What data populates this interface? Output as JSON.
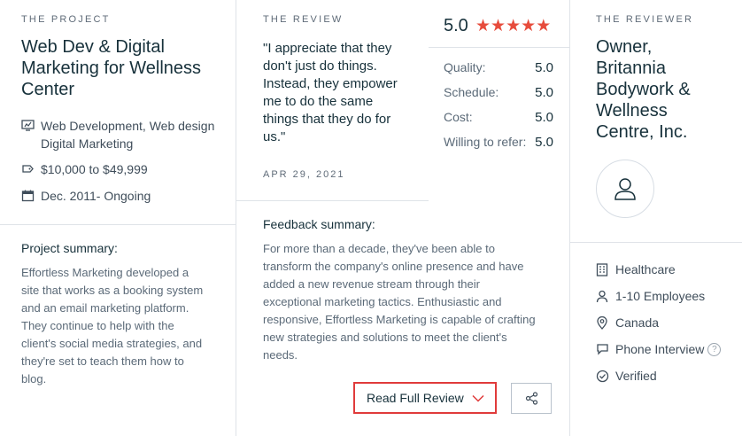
{
  "project": {
    "eyebrow": "THE PROJECT",
    "title_lines": [
      "Web Dev & Digital",
      "Marketing for Wellness",
      "Center"
    ],
    "services_line1": "Web Development, Web design",
    "services_line2": "Digital Marketing",
    "budget": "$10,000 to $49,999",
    "timeline": "Dec. 2011- Ongoing",
    "summary_heading": "Project summary:",
    "summary_lines": [
      "Effortless Marketing developed a",
      "site that works as a booking system",
      "and an email marketing platform.",
      "They continue to help with the",
      "client's social media strategies, and",
      "they're set to teach them how to",
      "blog."
    ],
    "icons": {
      "services": "monitor-chart-icon",
      "budget": "price-tag-icon",
      "timeline": "calendar-icon"
    }
  },
  "review": {
    "eyebrow": "THE REVIEW",
    "quote_lines": [
      "\"I appreciate that they",
      "don't just do things.",
      "Instead, they empower",
      "me to do the same",
      "things that they do for",
      "us.\""
    ],
    "date": "APR 29, 2021",
    "overall_score": "5.0",
    "stars": 5,
    "ratings": [
      {
        "label": "Quality:",
        "value": "5.0"
      },
      {
        "label": "Schedule:",
        "value": "5.0"
      },
      {
        "label": "Cost:",
        "value": "5.0"
      },
      {
        "label": "Willing to refer:",
        "value": "5.0"
      }
    ],
    "feedback_heading": "Feedback summary:",
    "feedback_lines": [
      "For more than a decade, they've been able to",
      "transform the company's online presence and have",
      "added a new revenue stream through their",
      "exceptional marketing tactics. Enthusiastic and",
      "responsive, Effortless Marketing is capable of crafting",
      "new strategies and solutions to meet the client's",
      "needs."
    ],
    "read_full_label": "Read Full Review",
    "icons": {
      "dropdown": "chevron-down-icon",
      "share": "share-icon"
    }
  },
  "reviewer": {
    "eyebrow": "THE REVIEWER",
    "title_lines": [
      "Owner,",
      "Britannia",
      "Bodywork &",
      "Wellness",
      "Centre, Inc."
    ],
    "details": [
      {
        "icon": "building-icon",
        "text": "Healthcare"
      },
      {
        "icon": "person-icon",
        "text": "1-10 Employees"
      },
      {
        "icon": "location-pin-icon",
        "text": "Canada"
      },
      {
        "icon": "chat-bubble-icon",
        "text": "Phone Interview"
      },
      {
        "icon": "check-circle-icon",
        "text": "Verified"
      }
    ],
    "help_icon": "question-mark-icon"
  },
  "colors": {
    "accent": "#e74c3c",
    "text": "#17313b",
    "muted": "#5b6a78",
    "divider": "#dfe3e8"
  }
}
